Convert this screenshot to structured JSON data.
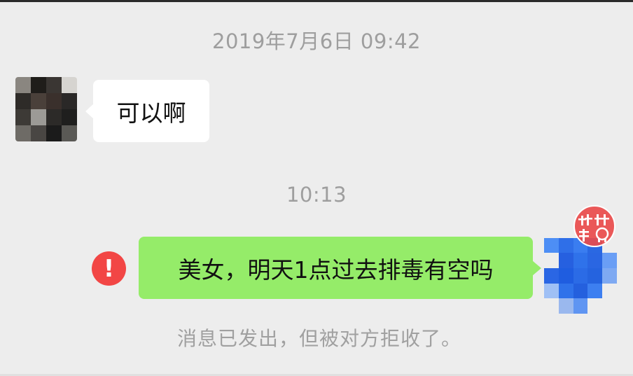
{
  "conversation": {
    "timestamp_1": "2019年7月6日 09:42",
    "timestamp_2": "10:13",
    "incoming_message": "可以啊",
    "outgoing_message": "美女，明天1点过去排毒有空吗",
    "send_error_symbol": "!",
    "rejected_notice": "消息已发出，但被对方拒收了。"
  },
  "watermark": {
    "text": "桂林事儿"
  },
  "colors": {
    "background": "#ededed",
    "incoming_bubble": "#ffffff",
    "outgoing_bubble": "#95ec69",
    "error_icon": "#f24645",
    "timestamp_text": "#9e9e9e"
  },
  "icons": {
    "error": "exclamation-circle-icon",
    "watermark": "logo-watermark-icon"
  }
}
